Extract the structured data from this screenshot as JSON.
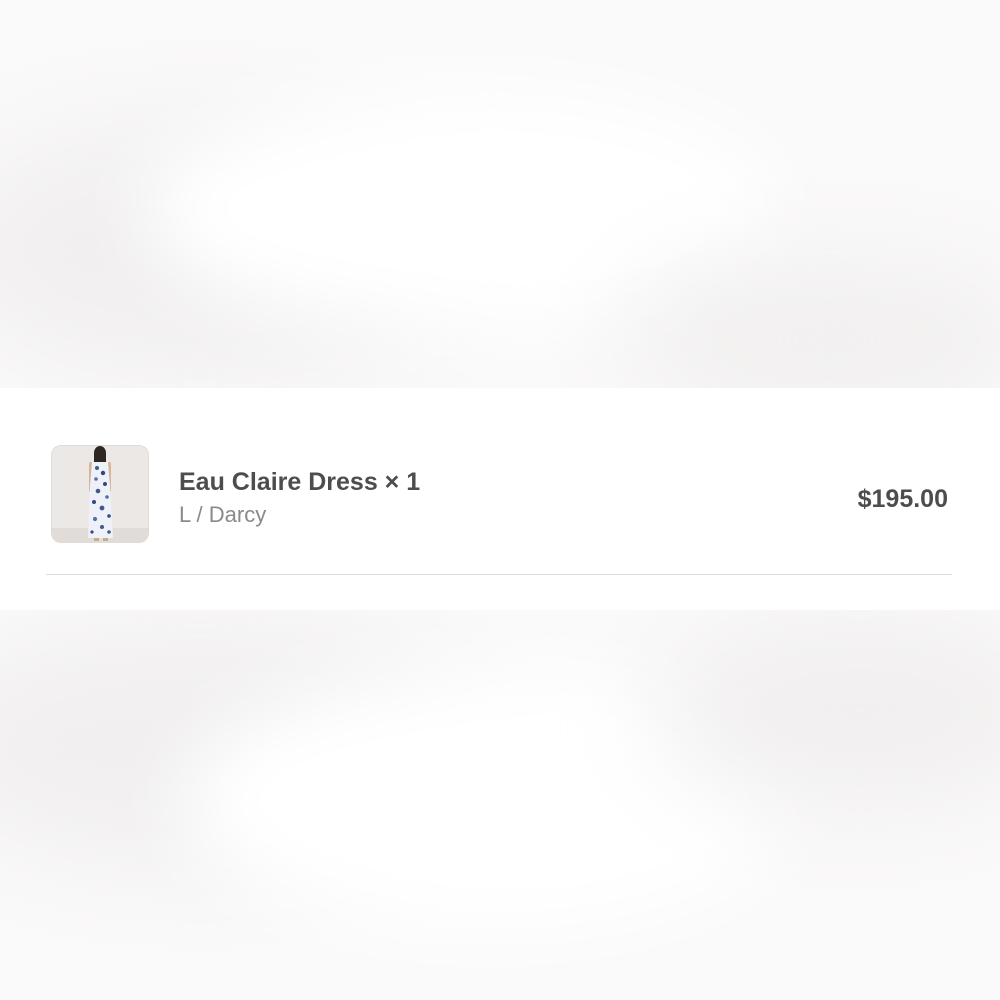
{
  "cart_item": {
    "name": "Eau Claire Dress × 1",
    "variant": "L / Darcy",
    "price": "$195.00",
    "thumbnail_icon": "dress-photo"
  }
}
